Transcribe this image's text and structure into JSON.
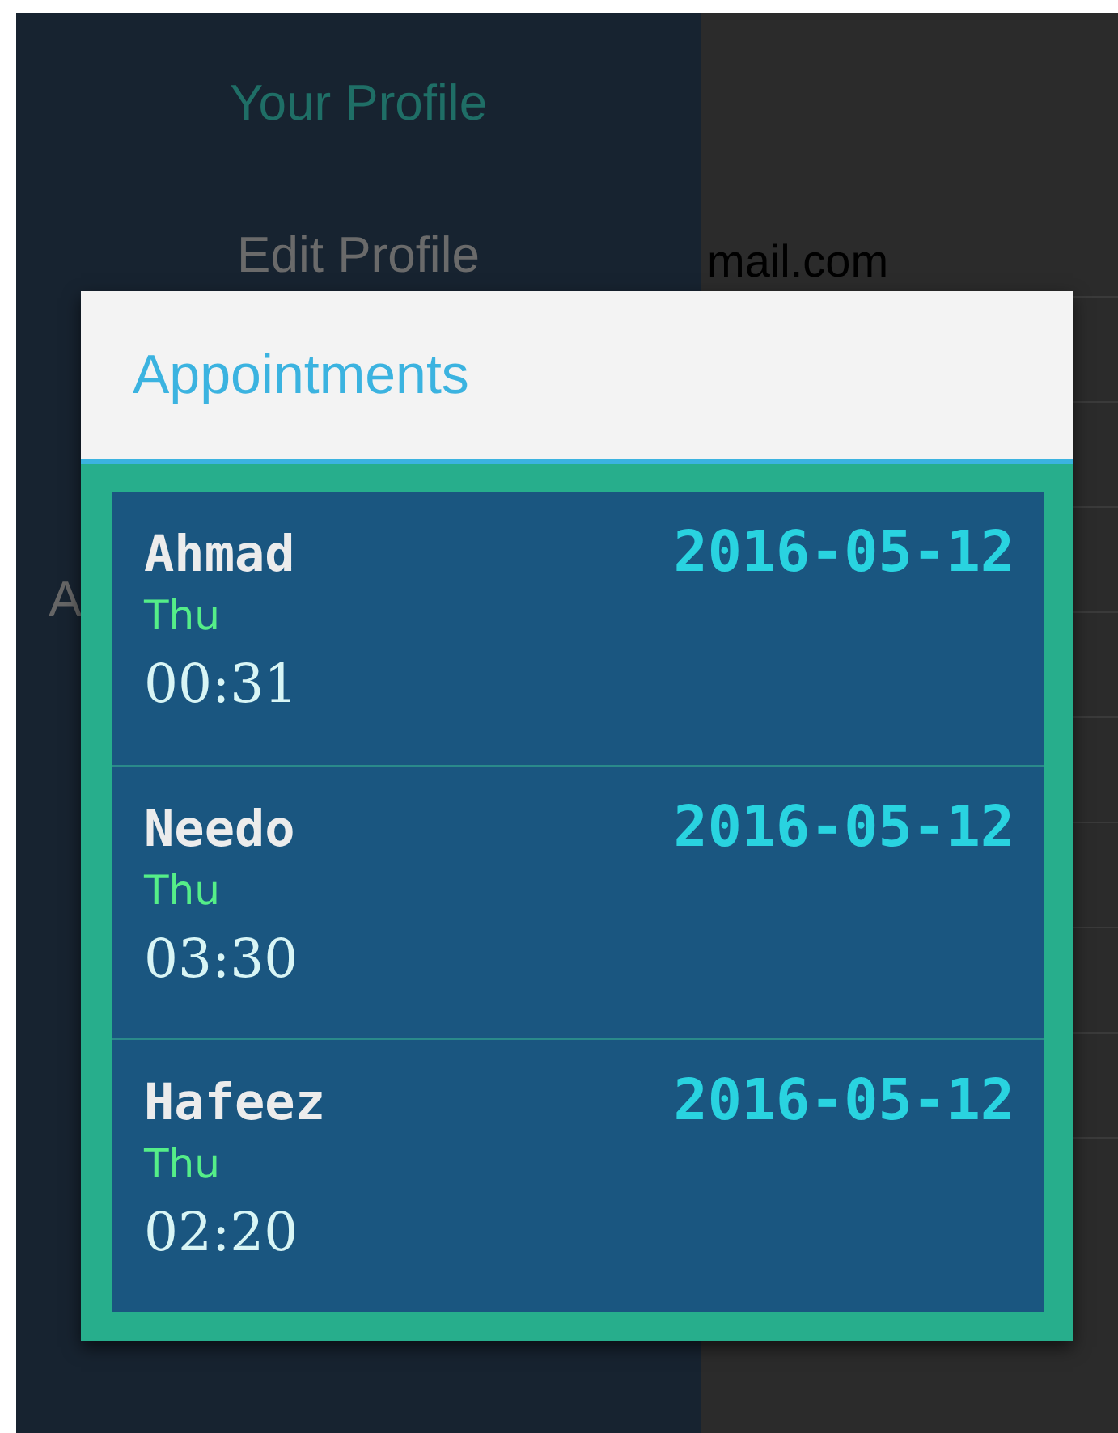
{
  "sidebar": {
    "items": [
      {
        "label": "Your Profile",
        "selected": true
      },
      {
        "label": "Edit Profile",
        "selected": false
      }
    ],
    "partial_label": "A"
  },
  "content": {
    "email_fragment": "mail.com"
  },
  "dialog": {
    "title": "Appointments",
    "appointments": [
      {
        "name": "Ahmad",
        "date": "2016-05-12",
        "day": "Thu",
        "time": "00:31"
      },
      {
        "name": "Needo",
        "date": "2016-05-12",
        "day": "Thu",
        "time": "03:30"
      },
      {
        "name": "Hafeez",
        "date": "2016-05-12",
        "day": "Thu",
        "time": "02:20"
      }
    ]
  }
}
